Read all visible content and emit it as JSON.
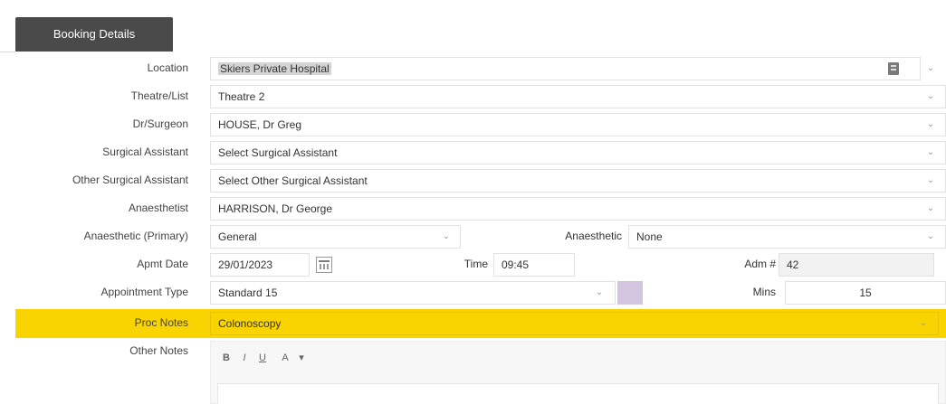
{
  "tab": {
    "label": "Booking Details"
  },
  "form": {
    "location": {
      "label": "Location",
      "value": "Skiers Private Hospital"
    },
    "theatre": {
      "label": "Theatre/List",
      "value": "Theatre 2"
    },
    "surgeon": {
      "label": "Dr/Surgeon",
      "value": "HOUSE, Dr Greg"
    },
    "surgical_assistant": {
      "label": "Surgical Assistant",
      "placeholder": "Select Surgical Assistant"
    },
    "other_assistant": {
      "label": "Other Surgical Assistant",
      "placeholder": "Select Other Surgical Assistant"
    },
    "anaesthetist": {
      "label": "Anaesthetist",
      "value": "HARRISON, Dr George"
    },
    "anaesthetic_primary": {
      "label": "Anaesthetic (Primary)",
      "value": "General"
    },
    "anaesthetic_secondary": {
      "label": "Anaesthetic",
      "value": "None"
    },
    "appt_date": {
      "label": "Apmt Date",
      "value": "29/01/2023"
    },
    "time": {
      "label": "Time",
      "value": "09:45"
    },
    "adm": {
      "label": "Adm #",
      "value": "42"
    },
    "appointment_type": {
      "label": "Appointment Type",
      "value": "Standard 15"
    },
    "mins": {
      "label": "Mins",
      "value": "15"
    },
    "proc_notes": {
      "label": "Proc Notes",
      "value": "Colonoscopy"
    },
    "other_notes": {
      "label": "Other Notes"
    }
  },
  "toolbar": {
    "bold": "B",
    "italic": "I",
    "underline": "U",
    "font_color": "A",
    "more": "▾"
  },
  "icons": {
    "chevron": "chevron-down-icon",
    "calendar": "calendar-icon",
    "bookmark": "bookmark-icon"
  },
  "colors": {
    "highlight": "#f9d400",
    "tab": "#4a4a4a",
    "swatch": "#d5c6df"
  }
}
